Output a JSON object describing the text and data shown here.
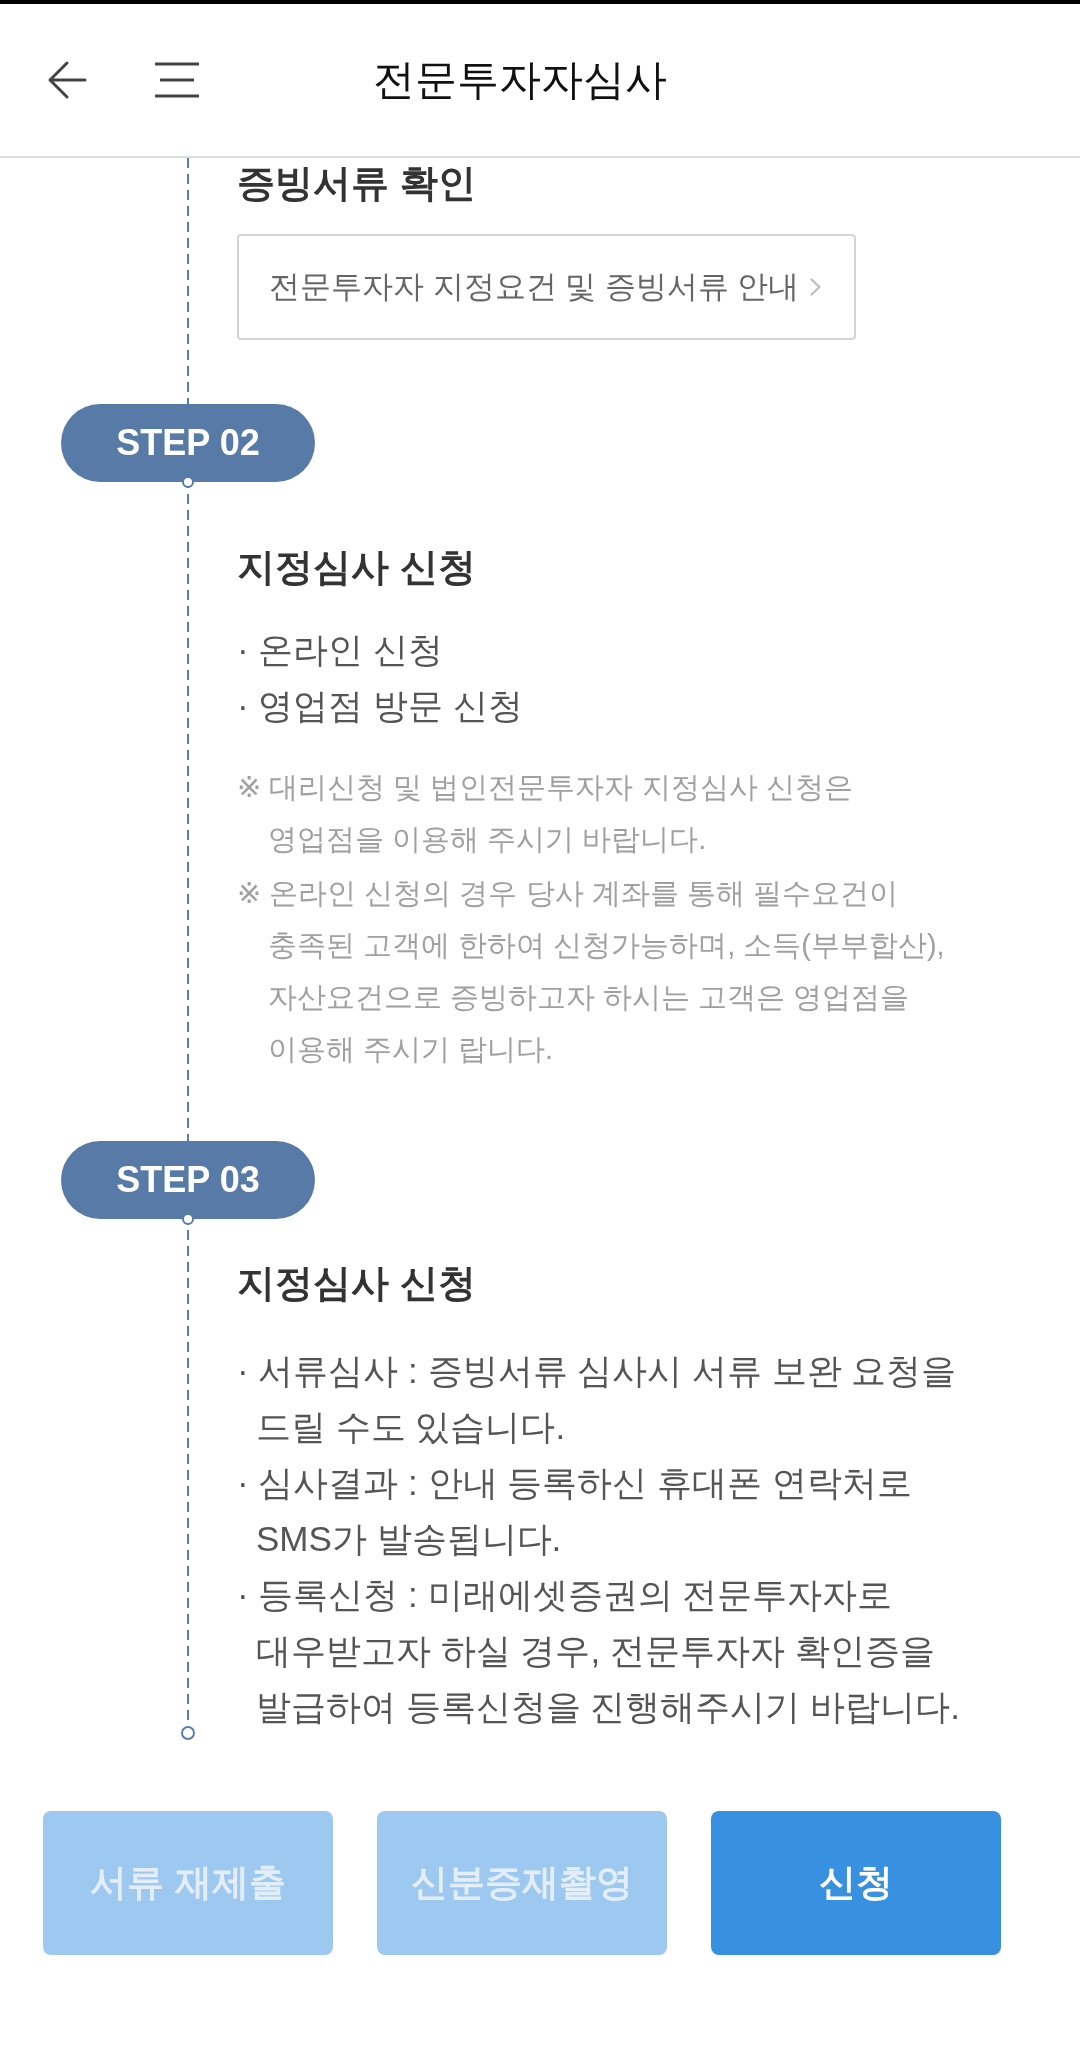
{
  "header": {
    "title": "전문투자자심사"
  },
  "document_check": {
    "heading": "증빙서류 확인",
    "link": "전문투자자 지정요건 및 증빙서류 안내"
  },
  "steps": [
    {
      "badge": "STEP 02",
      "heading": "지정심사 신청",
      "items": [
        "· 온라인 신청",
        "· 영업점 방문 신청"
      ],
      "notes": [
        "※ 대리신청 및 법인전문투자자 지정심사 신청은 영업점을 이용해 주시기 바랍니다.",
        "※ 온라인 신청의 경우 당사 계좌를 통해 필수요건이 충족된 고객에 한하여 신청가능하며, 소득(부부합산), 자산요건으로 증빙하고자 하시는 고객은 영업점을 이용해 주시기 랍니다."
      ]
    },
    {
      "badge": "STEP 03",
      "heading": "지정심사 신청",
      "items": [
        "· 서류심사 : 증빙서류 심사시 서류 보완 요청을 드릴 수도 있습니다.",
        "· 심사결과 : 안내 등록하신 휴대폰 연락처로 SMS가 발송됩니다.",
        "· 등록신청 : 미래에셋증권의 전문투자자로 대우받고자 하실 경우, 전문투자자 확인증을 발급하여 등록신청을 진행해주시기 바랍니다."
      ]
    }
  ],
  "buttons": [
    {
      "label": "서류 재제출",
      "disabled": true
    },
    {
      "label": "신분증재촬영",
      "disabled": true
    },
    {
      "label": "신청",
      "disabled": false
    }
  ]
}
